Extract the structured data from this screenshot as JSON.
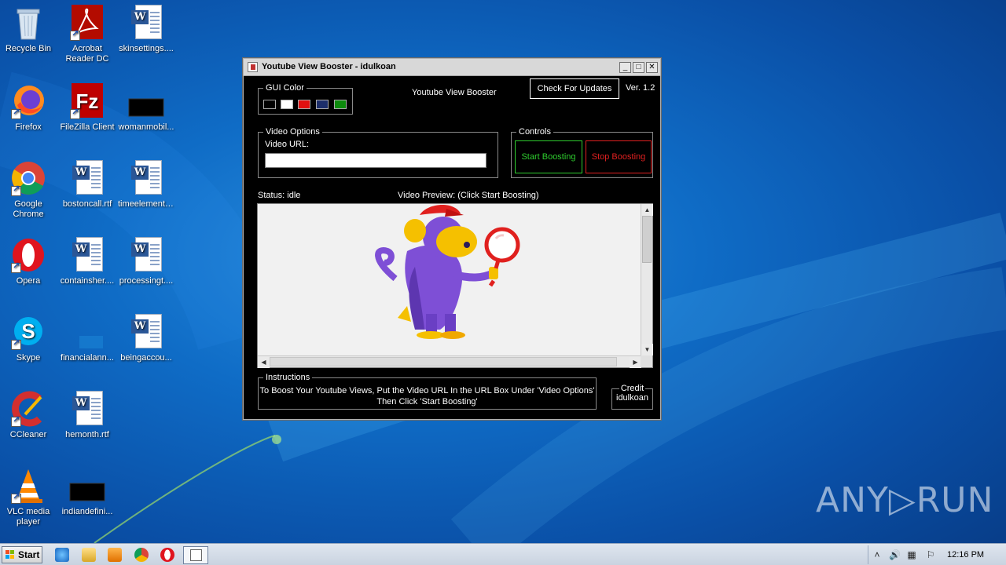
{
  "desktop": {
    "icons": [
      {
        "name": "Recycle Bin"
      },
      {
        "name": "Acrobat Reader DC"
      },
      {
        "name": "skinsettings...."
      },
      {
        "name": "Firefox"
      },
      {
        "name": "FileZilla Client"
      },
      {
        "name": "womanmobil..."
      },
      {
        "name": "Google Chrome"
      },
      {
        "name": "bostoncall.rtf"
      },
      {
        "name": "timeelement...."
      },
      {
        "name": "Opera"
      },
      {
        "name": "containsher...."
      },
      {
        "name": "processingt...."
      },
      {
        "name": "Skype"
      },
      {
        "name": "financialann..."
      },
      {
        "name": "beingaccou..."
      },
      {
        "name": "CCleaner"
      },
      {
        "name": "hemonth.rtf"
      },
      {
        "name": "VLC media player"
      },
      {
        "name": "indiandefini..."
      }
    ]
  },
  "window": {
    "title": "Youtube View Booster - idulkoan",
    "app_title": "Youtube View Booster",
    "check_updates_label": "Check For Updates",
    "version": "Ver. 1.2",
    "gui_color": {
      "label": "GUI Color",
      "swatches": [
        "#000000",
        "#ffffff",
        "#e21010",
        "#1c2e6b",
        "#0c8a0c"
      ]
    },
    "video_options": {
      "label": "Video Options",
      "url_label": "Video URL:",
      "url_value": ""
    },
    "controls": {
      "label": "Controls",
      "start_label": "Start Boosting",
      "stop_label": "Stop Boosting",
      "start_color": "#2ecc2e",
      "stop_color": "#e02020"
    },
    "status_text": "Status: idle",
    "preview_label": "Video Preview: (Click Start Boosting)",
    "instructions": {
      "label": "Instructions",
      "line1": "To Boost Your Youtube Views, Put the Video URL In the URL Box Under 'Video Options'",
      "line2": "Then Click 'Start Boosting'"
    },
    "credit": {
      "label": "Credit",
      "name": "idulkoan"
    }
  },
  "taskbar": {
    "start_label": "Start",
    "clock": "12:16 PM"
  },
  "watermark": "ANY▷RUN"
}
